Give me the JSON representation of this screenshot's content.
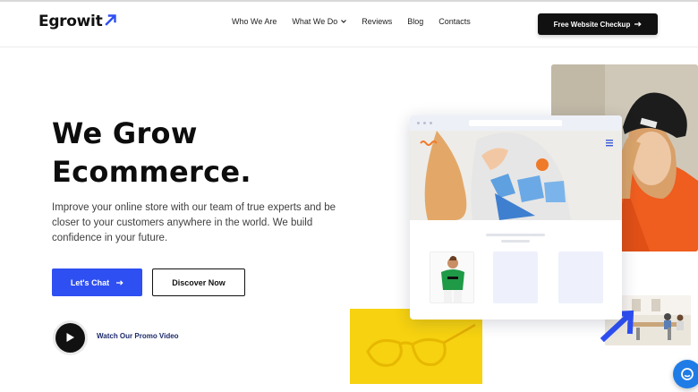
{
  "brand": {
    "name": "Egrowit",
    "accent": "#2e4ff2",
    "dark": "#111111"
  },
  "nav": {
    "items": [
      {
        "label": "Who We Are"
      },
      {
        "label": "What We Do",
        "has_dropdown": true
      },
      {
        "label": "Reviews"
      },
      {
        "label": "Blog"
      },
      {
        "label": "Contacts"
      }
    ],
    "cta_label": "Free Website Checkup"
  },
  "hero": {
    "title_line1": "We Grow",
    "title_line2": "Ecommerce.",
    "description": "Improve your online store with our team of true experts and be closer to your customers anywhere in the world. We build confidence in your future.",
    "primary_button": "Let's Chat",
    "secondary_button": "Discover Now",
    "promo_label": "Watch Our Promo Video"
  },
  "icons": {
    "logo": "arrow-up-right-icon",
    "dropdown": "chevron-down-icon",
    "cta": "arrow-right-icon",
    "play": "play-icon",
    "chat": "chat-icon",
    "menu": "hamburger-icon"
  }
}
